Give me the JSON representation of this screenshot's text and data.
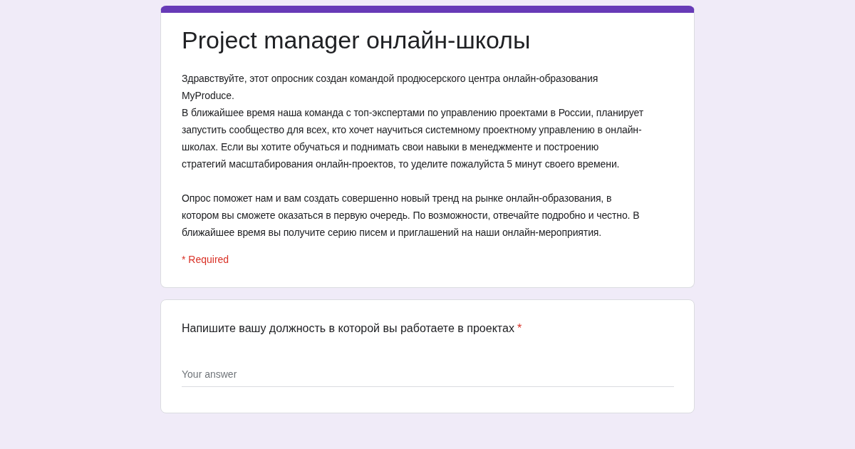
{
  "form": {
    "title": "Project manager онлайн-школы",
    "description": [
      [
        "Здравствуйте, этот опросник создан командой продюсерского центра онлайн-образования MyProduce.",
        "В ближайшее время наша команда с топ-экспертами по управлению проектами в России, планирует запустить сообщество для всех, кто хочет научиться системному проектному управлению в онлайн-школах. Если вы хотите обучаться и поднимать свои навыки в менеджменте и построению стратегий масштабирования онлайн-проектов, то уделите пожалуйста 5 минут своего времени."
      ],
      [
        "Опрос поможет нам и вам создать совершенно новый тренд на рынке онлайн-образования, в котором вы сможете оказаться в первую очередь. По возможности, отвечайте подробно и честно. В ближайшее время вы получите серию писем и приглашений на наши онлайн-мероприятия."
      ]
    ],
    "required_note": "* Required"
  },
  "questions": [
    {
      "text": "Напишите вашу должность в которой вы работаете в проектах",
      "required_mark": "*",
      "placeholder": "Your answer"
    }
  ]
}
